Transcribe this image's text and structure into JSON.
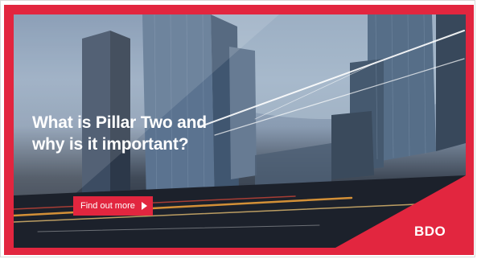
{
  "banner": {
    "headline": "What is Pillar Two and\nwhy is it important?",
    "cta_label": "Find out more",
    "cta_icon": "play-arrow-icon",
    "logo_text": "BDO",
    "brand_color": "#e2263f"
  }
}
